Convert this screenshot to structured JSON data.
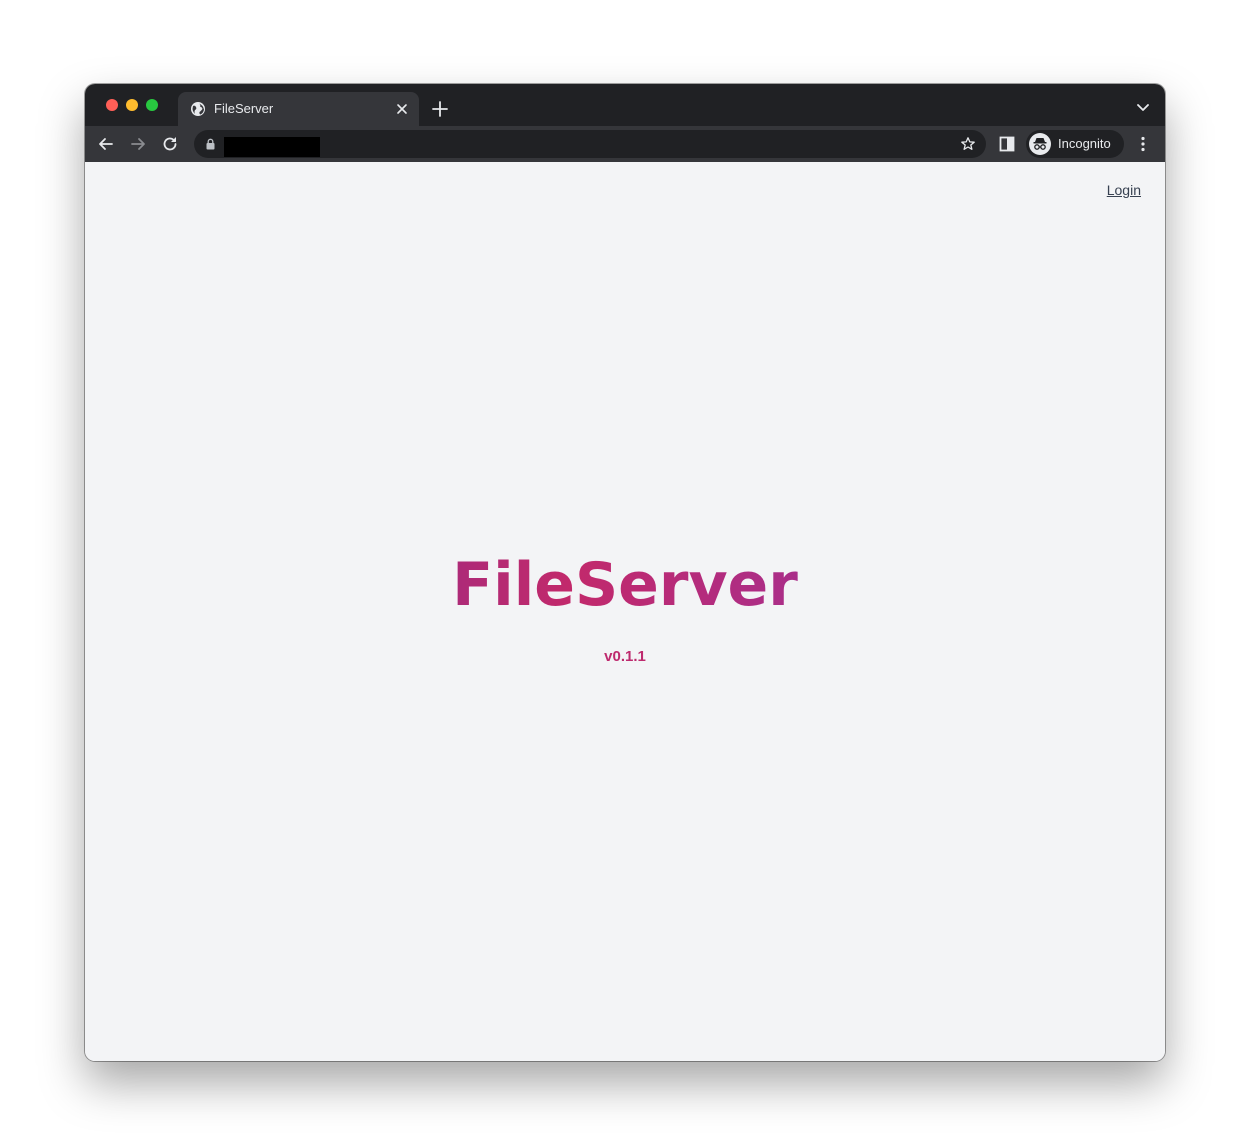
{
  "browser": {
    "tab": {
      "title": "FileServer",
      "favicon": "globe-icon",
      "close_icon": "close-icon"
    },
    "new_tab_icon": "plus-icon",
    "tab_menu_icon": "chevron-down-icon",
    "nav": {
      "back_icon": "back-arrow-icon",
      "forward_icon": "forward-arrow-icon",
      "reload_icon": "reload-icon"
    },
    "omnibox": {
      "lock_icon": "lock-icon",
      "url": "",
      "bookmark_icon": "star-icon"
    },
    "side_panel_icon": "side-panel-icon",
    "profile": {
      "label": "Incognito",
      "icon": "incognito-icon"
    },
    "menu_icon": "kebab-menu-icon"
  },
  "page": {
    "login_label": "Login",
    "title": "FileServer",
    "version": "v0.1.1"
  },
  "colors": {
    "window_chrome": "#202124",
    "toolbar": "#35363a",
    "page_background": "#f3f4f6",
    "title_gradient_start": "#6b2fa0",
    "title_gradient_mid": "#c2296b",
    "title_gradient_end": "#6b35a8",
    "version_color": "#be2a6e"
  }
}
